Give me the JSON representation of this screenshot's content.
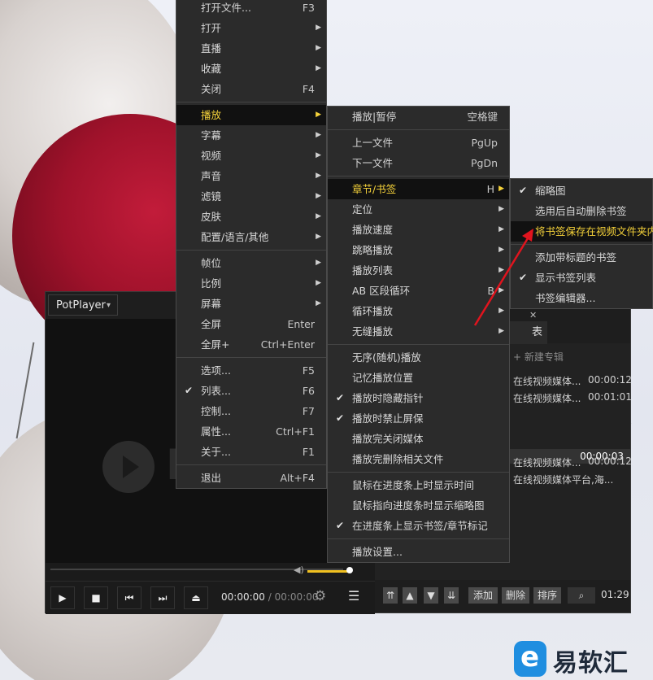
{
  "player": {
    "title": "PotPlayer",
    "time_current": "00:00:00",
    "time_separator": "/",
    "time_total": "00:00:00",
    "logo_letter": "P"
  },
  "playlist": {
    "tab_label": "表",
    "new_album": "+ 新建专辑",
    "rows_top": [
      {
        "name": "在线视频媒体...",
        "time": "00:00:12"
      },
      {
        "name": "在线视频媒体...",
        "time": "00:01:01"
      }
    ],
    "group_total": "00:00:03",
    "rows_bottom": [
      {
        "name": "在线视频媒体...",
        "time": "00:00:12"
      },
      {
        "name": "在线视频媒体平台,海...",
        "time": ""
      }
    ],
    "buttons": {
      "add": "添加",
      "delete": "删除",
      "sort": "排序"
    },
    "total_time": "01:29"
  },
  "main_menu": {
    "groups": [
      [
        {
          "label": "打开文件...",
          "shortcut": "F3"
        },
        {
          "label": "打开",
          "submenu": true
        },
        {
          "label": "直播",
          "submenu": true
        },
        {
          "label": "收藏",
          "submenu": true
        },
        {
          "label": "关闭",
          "shortcut": "F4"
        }
      ],
      [
        {
          "label": "播放",
          "submenu": true,
          "highlighted": true
        },
        {
          "label": "字幕",
          "submenu": true
        },
        {
          "label": "视频",
          "submenu": true
        },
        {
          "label": "声音",
          "submenu": true
        },
        {
          "label": "滤镜",
          "submenu": true
        },
        {
          "label": "皮肤",
          "submenu": true
        },
        {
          "label": "配置/语言/其他",
          "submenu": true
        }
      ],
      [
        {
          "label": "帧位",
          "submenu": true
        },
        {
          "label": "比例",
          "submenu": true
        },
        {
          "label": "屏幕",
          "submenu": true
        },
        {
          "label": "全屏",
          "shortcut": "Enter"
        },
        {
          "label": "全屏+",
          "shortcut": "Ctrl+Enter"
        }
      ],
      [
        {
          "label": "选项...",
          "shortcut": "F5"
        },
        {
          "label": "列表...",
          "shortcut": "F6",
          "checked": true
        },
        {
          "label": "控制...",
          "shortcut": "F7"
        },
        {
          "label": "属性...",
          "shortcut": "Ctrl+F1"
        },
        {
          "label": "关于...",
          "shortcut": "F1"
        }
      ],
      [
        {
          "label": "退出",
          "shortcut": "Alt+F4"
        }
      ]
    ]
  },
  "play_menu": {
    "groups": [
      [
        {
          "label": "播放|暂停",
          "shortcut": "空格键"
        }
      ],
      [
        {
          "label": "上一文件",
          "shortcut": "PgUp"
        },
        {
          "label": "下一文件",
          "shortcut": "PgDn"
        }
      ],
      [
        {
          "label": "章节/书签",
          "shortcut": "H",
          "submenu": true,
          "highlighted": true
        },
        {
          "label": "定位",
          "submenu": true
        },
        {
          "label": "播放速度",
          "submenu": true
        },
        {
          "label": "跳略播放",
          "submenu": true
        },
        {
          "label": "播放列表",
          "submenu": true
        },
        {
          "label": "AB 区段循环",
          "shortcut": "B",
          "submenu": true
        },
        {
          "label": "循环播放",
          "submenu": true
        },
        {
          "label": "无缝播放",
          "submenu": true
        }
      ],
      [
        {
          "label": "无序(随机)播放"
        },
        {
          "label": "记忆播放位置"
        },
        {
          "label": "播放时隐藏指针",
          "checked": true
        },
        {
          "label": "播放时禁止屏保",
          "checked": true
        },
        {
          "label": "播放完关闭媒体"
        },
        {
          "label": "播放完删除相关文件"
        }
      ],
      [
        {
          "label": "鼠标在进度条上时显示时间"
        },
        {
          "label": "鼠标指向进度条时显示缩略图"
        },
        {
          "label": "在进度条上显示书签/章节标记",
          "checked": true
        }
      ],
      [
        {
          "label": "播放设置..."
        }
      ]
    ]
  },
  "bookmark_menu": {
    "groups": [
      [
        {
          "label": "缩略图",
          "checked": true
        },
        {
          "label": "选用后自动删除书签"
        },
        {
          "label": "将书签保存在视频文件夹内",
          "highlighted": true
        }
      ],
      [
        {
          "label": "添加带标题的书签"
        },
        {
          "label": "显示书签列表",
          "checked": true
        },
        {
          "label": "书签编辑器..."
        }
      ]
    ]
  },
  "watermark": {
    "text": "易软汇"
  },
  "colors": {
    "highlight_text": "#f5d23a",
    "menu_bg": "#2b2b2b",
    "annotation_arrow": "#e0141e",
    "volume": "#f0c020"
  }
}
